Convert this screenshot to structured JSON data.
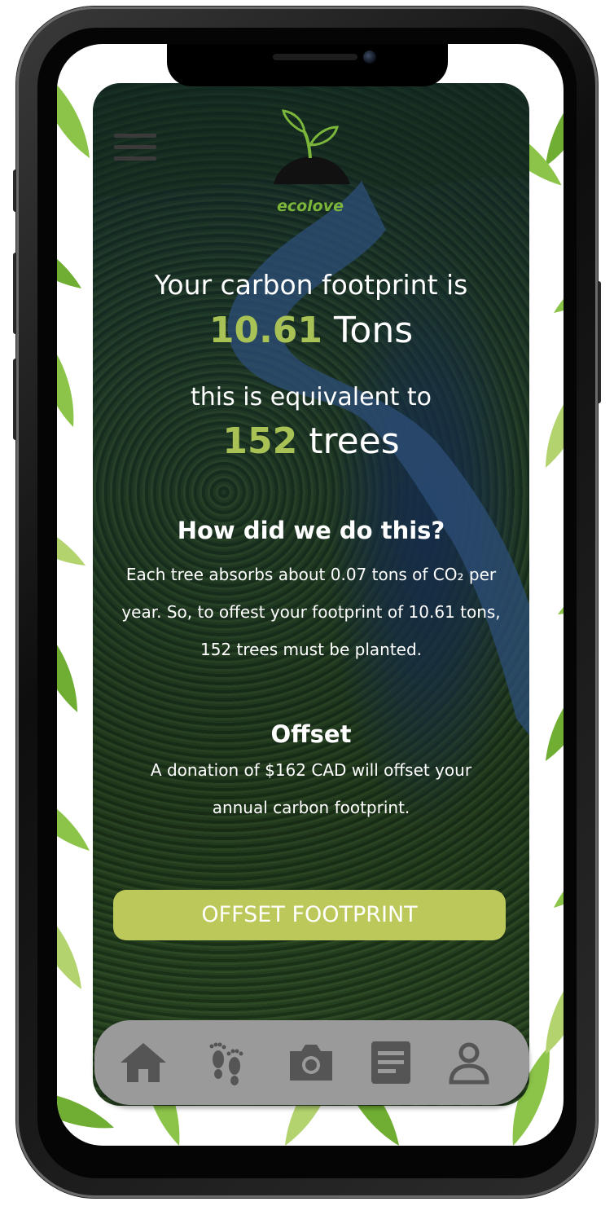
{
  "app": {
    "name": "ecolove"
  },
  "result": {
    "headline": "Your carbon footprint is",
    "tons_value": "10.61",
    "tons_unit": " Tons",
    "equivalent_label": "this is equivalent to",
    "trees_value": "152",
    "trees_unit": " trees"
  },
  "explanation": {
    "heading": "How did we do this?",
    "body": "Each tree absorbs about 0.07 tons of CO₂ per year.  So, to offest your footprint of 10.61 tons, 152 trees must be planted."
  },
  "offset": {
    "heading": "Offset",
    "body": "A donation of $162 CAD will offset your annual carbon footprint.",
    "button_label": "OFFSET FOOTPRINT"
  },
  "tabbar": {
    "items": [
      {
        "icon": "home-icon"
      },
      {
        "icon": "footprints-icon"
      },
      {
        "icon": "camera-icon"
      },
      {
        "icon": "document-icon"
      },
      {
        "icon": "profile-icon"
      }
    ]
  },
  "colors": {
    "accent_green": "#a8c256",
    "button": "#bdc85a",
    "logo_green": "#7bb53a",
    "tabbar": "#9a9a9a",
    "tab_icon": "#555555"
  }
}
